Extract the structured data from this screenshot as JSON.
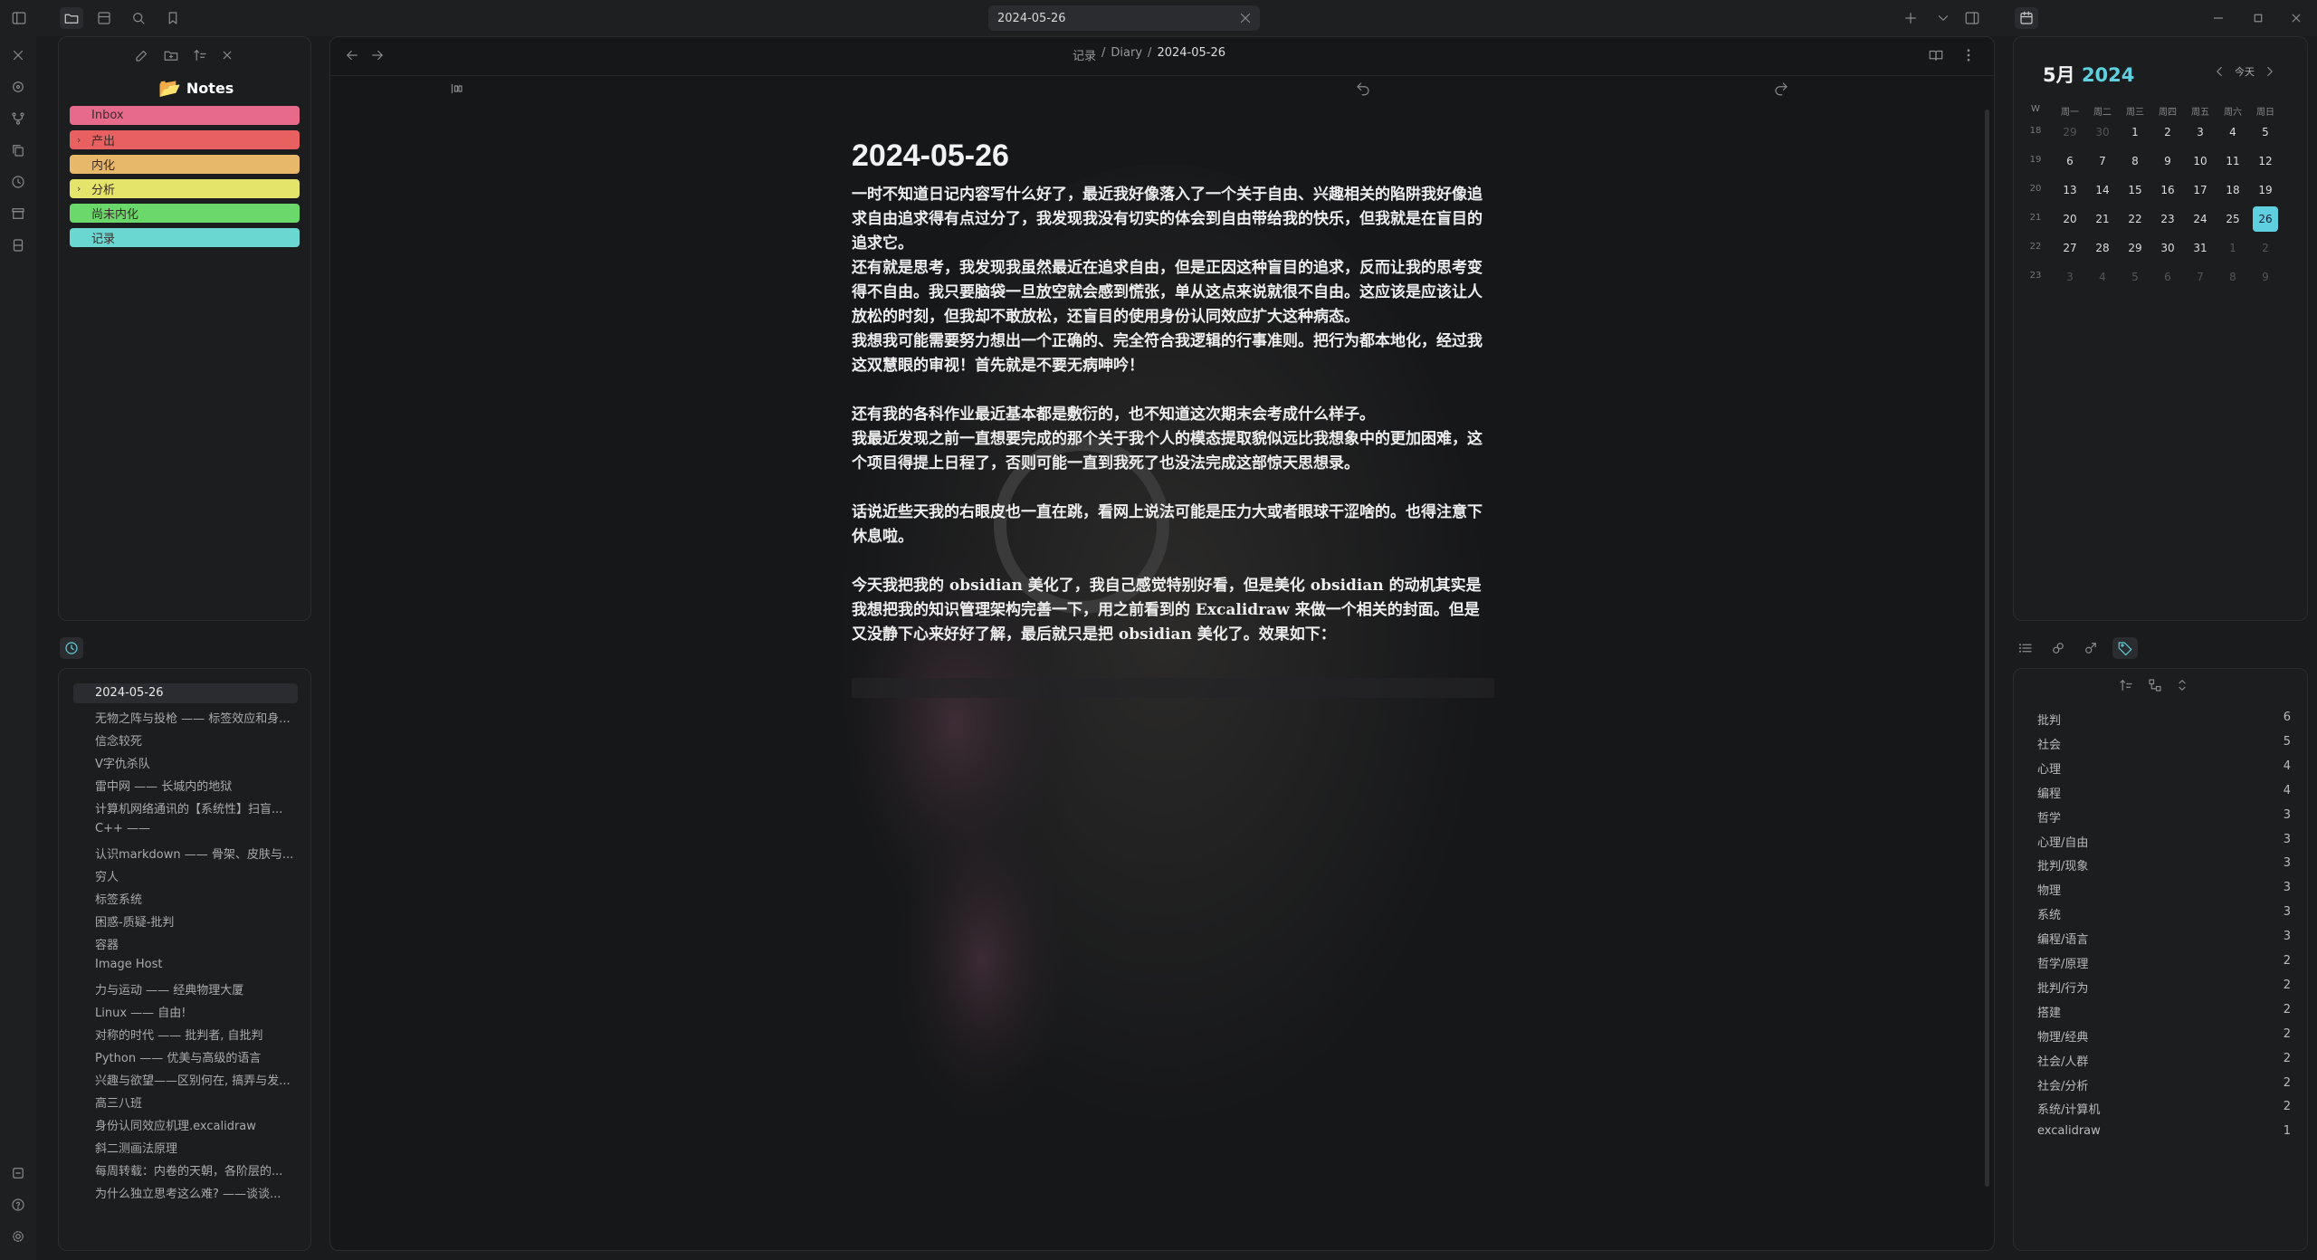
{
  "tab": {
    "title": "2024-05-26"
  },
  "breadcrumb": {
    "part1": "记录",
    "sep1": "/",
    "part2": "Diary",
    "sep2": "/",
    "current": "2024-05-26"
  },
  "explorer": {
    "title": "Notes",
    "folders": [
      {
        "label": "Inbox",
        "color": "#e86a8b",
        "chev": ""
      },
      {
        "label": "产出",
        "color": "#e86060",
        "chev": "›"
      },
      {
        "label": "内化",
        "color": "#e8b86a",
        "chev": ""
      },
      {
        "label": "分析",
        "color": "#e4e46a",
        "chev": "›"
      },
      {
        "label": "尚未内化",
        "color": "#6ad86a",
        "chev": ""
      },
      {
        "label": "记录",
        "color": "#6ad8d0",
        "chev": ""
      }
    ]
  },
  "recent": {
    "items": [
      "2024-05-26",
      "无物之阵与投枪 —— 标签效应和身...",
      "信念较死",
      "V字仇杀队",
      "雷中网 —— 长城内的地狱",
      "计算机网络通讯的【系统性】扫盲...",
      "C++ ——",
      "认识markdown —— 骨架、皮肤与...",
      "穷人",
      "标签系统",
      "困惑-质疑-批判",
      "容器",
      "Image Host",
      "力与运动 —— 经典物理大厦",
      "Linux —— 自由!",
      "对称的时代 —— 批判者, 自批判",
      "Python —— 优美与高级的语言",
      "兴趣与欲望——区别何在, 搞弄与发...",
      "高三八班",
      "身份认同效应机理.excalidraw",
      "斜二测画法原理",
      "每周转载：内卷的天朝，各阶层的...",
      "为什么独立思考这么难? ——谈谈..."
    ]
  },
  "note": {
    "title": "2024-05-26",
    "paragraphs": [
      "一时不知道日记内容写什么好了，最近我好像落入了一个关于自由、兴趣相关的陷阱我好像追求自由追求得有点过分了，我发现我没有切实的体会到自由带给我的快乐，但我就是在盲目的追求它。",
      "还有就是思考，我发现我虽然最近在追求自由，但是正因这种盲目的追求，反而让我的思考变得不自由。我只要脑袋一旦放空就会感到慌张，单从这点来说就很不自由。这应该是应该让人放松的时刻，但我却不敢放松，还盲目的使用身份认同效应扩大这种病态。",
      "我想我可能需要努力想出一个正确的、完全符合我逻辑的行事准则。把行为都本地化，经过我这双慧眼的审视！首先就是不要无病呻吟！",
      "",
      "还有我的各科作业最近基本都是敷衍的，也不知道这次期末会考成什么样子。",
      "我最近发现之前一直想要完成的那个关于我个人的模态提取貌似远比我想象中的更加困难，这个项目得提上日程了，否则可能一直到我死了也没法完成这部惊天思想录。",
      "",
      "话说近些天我的右眼皮也一直在跳，看网上说法可能是压力大或者眼球干涩啥的。也得注意下休息啦。",
      "",
      "今天我把我的 obsidian 美化了，我自己感觉特别好看，但是美化 obsidian 的动机其实是我想把我的知识管理架构完善一下，用之前看到的 Excalidraw 来做一个相关的封面。但是又没静下心来好好了解，最后就只是把 obsidian 美化了。效果如下："
    ]
  },
  "calendar": {
    "month": "5月",
    "year": "2024",
    "today_label": "今天",
    "weekdays": [
      "W",
      "周一",
      "周二",
      "周三",
      "周四",
      "周五",
      "周六",
      "周日"
    ],
    "weeks": [
      {
        "wk": "18",
        "days": [
          "29",
          "30",
          "1",
          "2",
          "3",
          "4",
          "5"
        ]
      },
      {
        "wk": "19",
        "days": [
          "6",
          "7",
          "8",
          "9",
          "10",
          "11",
          "12"
        ]
      },
      {
        "wk": "20",
        "days": [
          "13",
          "14",
          "15",
          "16",
          "17",
          "18",
          "19"
        ]
      },
      {
        "wk": "21",
        "days": [
          "20",
          "21",
          "22",
          "23",
          "24",
          "25",
          "26"
        ]
      },
      {
        "wk": "22",
        "days": [
          "27",
          "28",
          "29",
          "30",
          "31",
          "1",
          "2"
        ]
      },
      {
        "wk": "23",
        "days": [
          "3",
          "4",
          "5",
          "6",
          "7",
          "8",
          "9"
        ]
      }
    ]
  },
  "tags": {
    "items": [
      {
        "name": "批判",
        "count": "6"
      },
      {
        "name": "社会",
        "count": "5"
      },
      {
        "name": "心理",
        "count": "4"
      },
      {
        "name": "编程",
        "count": "4"
      },
      {
        "name": "哲学",
        "count": "3"
      },
      {
        "name": "心理/自由",
        "count": "3"
      },
      {
        "name": "批判/现象",
        "count": "3"
      },
      {
        "name": "物理",
        "count": "3"
      },
      {
        "name": "系统",
        "count": "3"
      },
      {
        "name": "编程/语言",
        "count": "3"
      },
      {
        "name": "哲学/原理",
        "count": "2"
      },
      {
        "name": "批判/行为",
        "count": "2"
      },
      {
        "name": "搭建",
        "count": "2"
      },
      {
        "name": "物理/经典",
        "count": "2"
      },
      {
        "name": "社会/人群",
        "count": "2"
      },
      {
        "name": "社会/分析",
        "count": "2"
      },
      {
        "name": "系统/计算机",
        "count": "2"
      },
      {
        "name": "excalidraw",
        "count": "1"
      }
    ]
  },
  "colors": {
    "accent": "#5fd0e0",
    "today_bg": "#5fd0e0"
  }
}
